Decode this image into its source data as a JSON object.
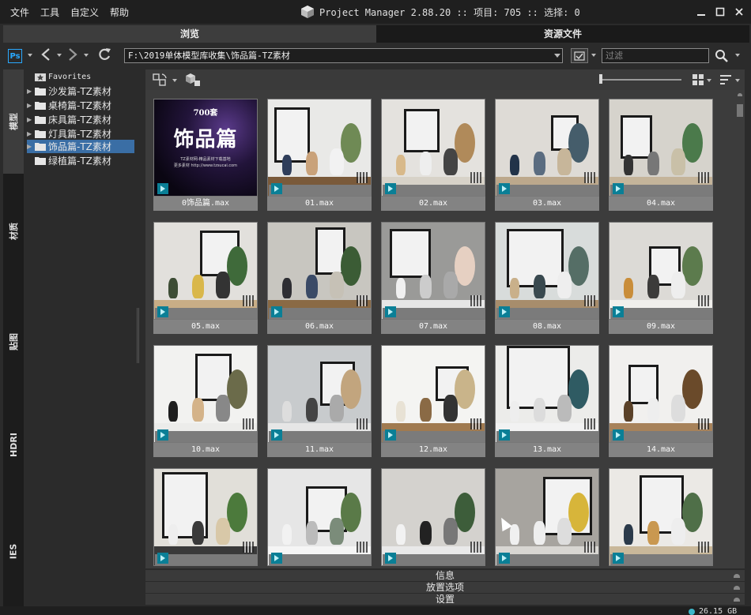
{
  "window": {
    "title": "Project Manager 2.88.20  :: 项目: 705  :: 选择: 0",
    "controls": [
      "minimize-icon",
      "maximize-icon",
      "close-icon"
    ]
  },
  "menu": [
    "文件",
    "工具",
    "自定义",
    "帮助"
  ],
  "tabs": [
    {
      "label": "浏览",
      "active": true
    },
    {
      "label": "资源文件",
      "active": false
    }
  ],
  "toolbar": {
    "ps_label": "Ps",
    "path": "F:\\2019单体模型库收集\\饰品篇-TZ素材",
    "filter_placeholder": "过滤"
  },
  "side_tabs": [
    "模型",
    "材质",
    "贴图",
    "HDRI",
    "IES"
  ],
  "tree": {
    "favorites": "Favorites",
    "folders": [
      {
        "label": "沙发篇-TZ素材",
        "expandable": true,
        "selected": false
      },
      {
        "label": "桌椅篇-TZ素材",
        "expandable": true,
        "selected": false
      },
      {
        "label": "床具篇-TZ素材",
        "expandable": true,
        "selected": false
      },
      {
        "label": "灯具篇-TZ素材",
        "expandable": true,
        "selected": false
      },
      {
        "label": "饰品篇-TZ素材",
        "expandable": true,
        "selected": true
      },
      {
        "label": "绿植篇-TZ素材",
        "expandable": false,
        "selected": false
      }
    ]
  },
  "cover": {
    "top": "700套",
    "main": "饰品篇",
    "sub": "TZ素材网-精品素材下载基地",
    "sub2": "更多素材 http://www.tzsucai.com"
  },
  "files": [
    "0饰品篇.max",
    "01.max",
    "02.max",
    "03.max",
    "04.max",
    "05.max",
    "06.max",
    "07.max",
    "08.max",
    "09.max",
    "10.max",
    "11.max",
    "12.max",
    "13.max",
    "14.max",
    "",
    "",
    "",
    "",
    ""
  ],
  "panels": [
    "信息",
    "放置选项",
    "设置"
  ],
  "status": {
    "disk": "26.15 GB"
  },
  "colors": {
    "accent": "#3a6ea5",
    "max_badge": "#0a7f96",
    "ps_blue": "#29a9ff"
  }
}
